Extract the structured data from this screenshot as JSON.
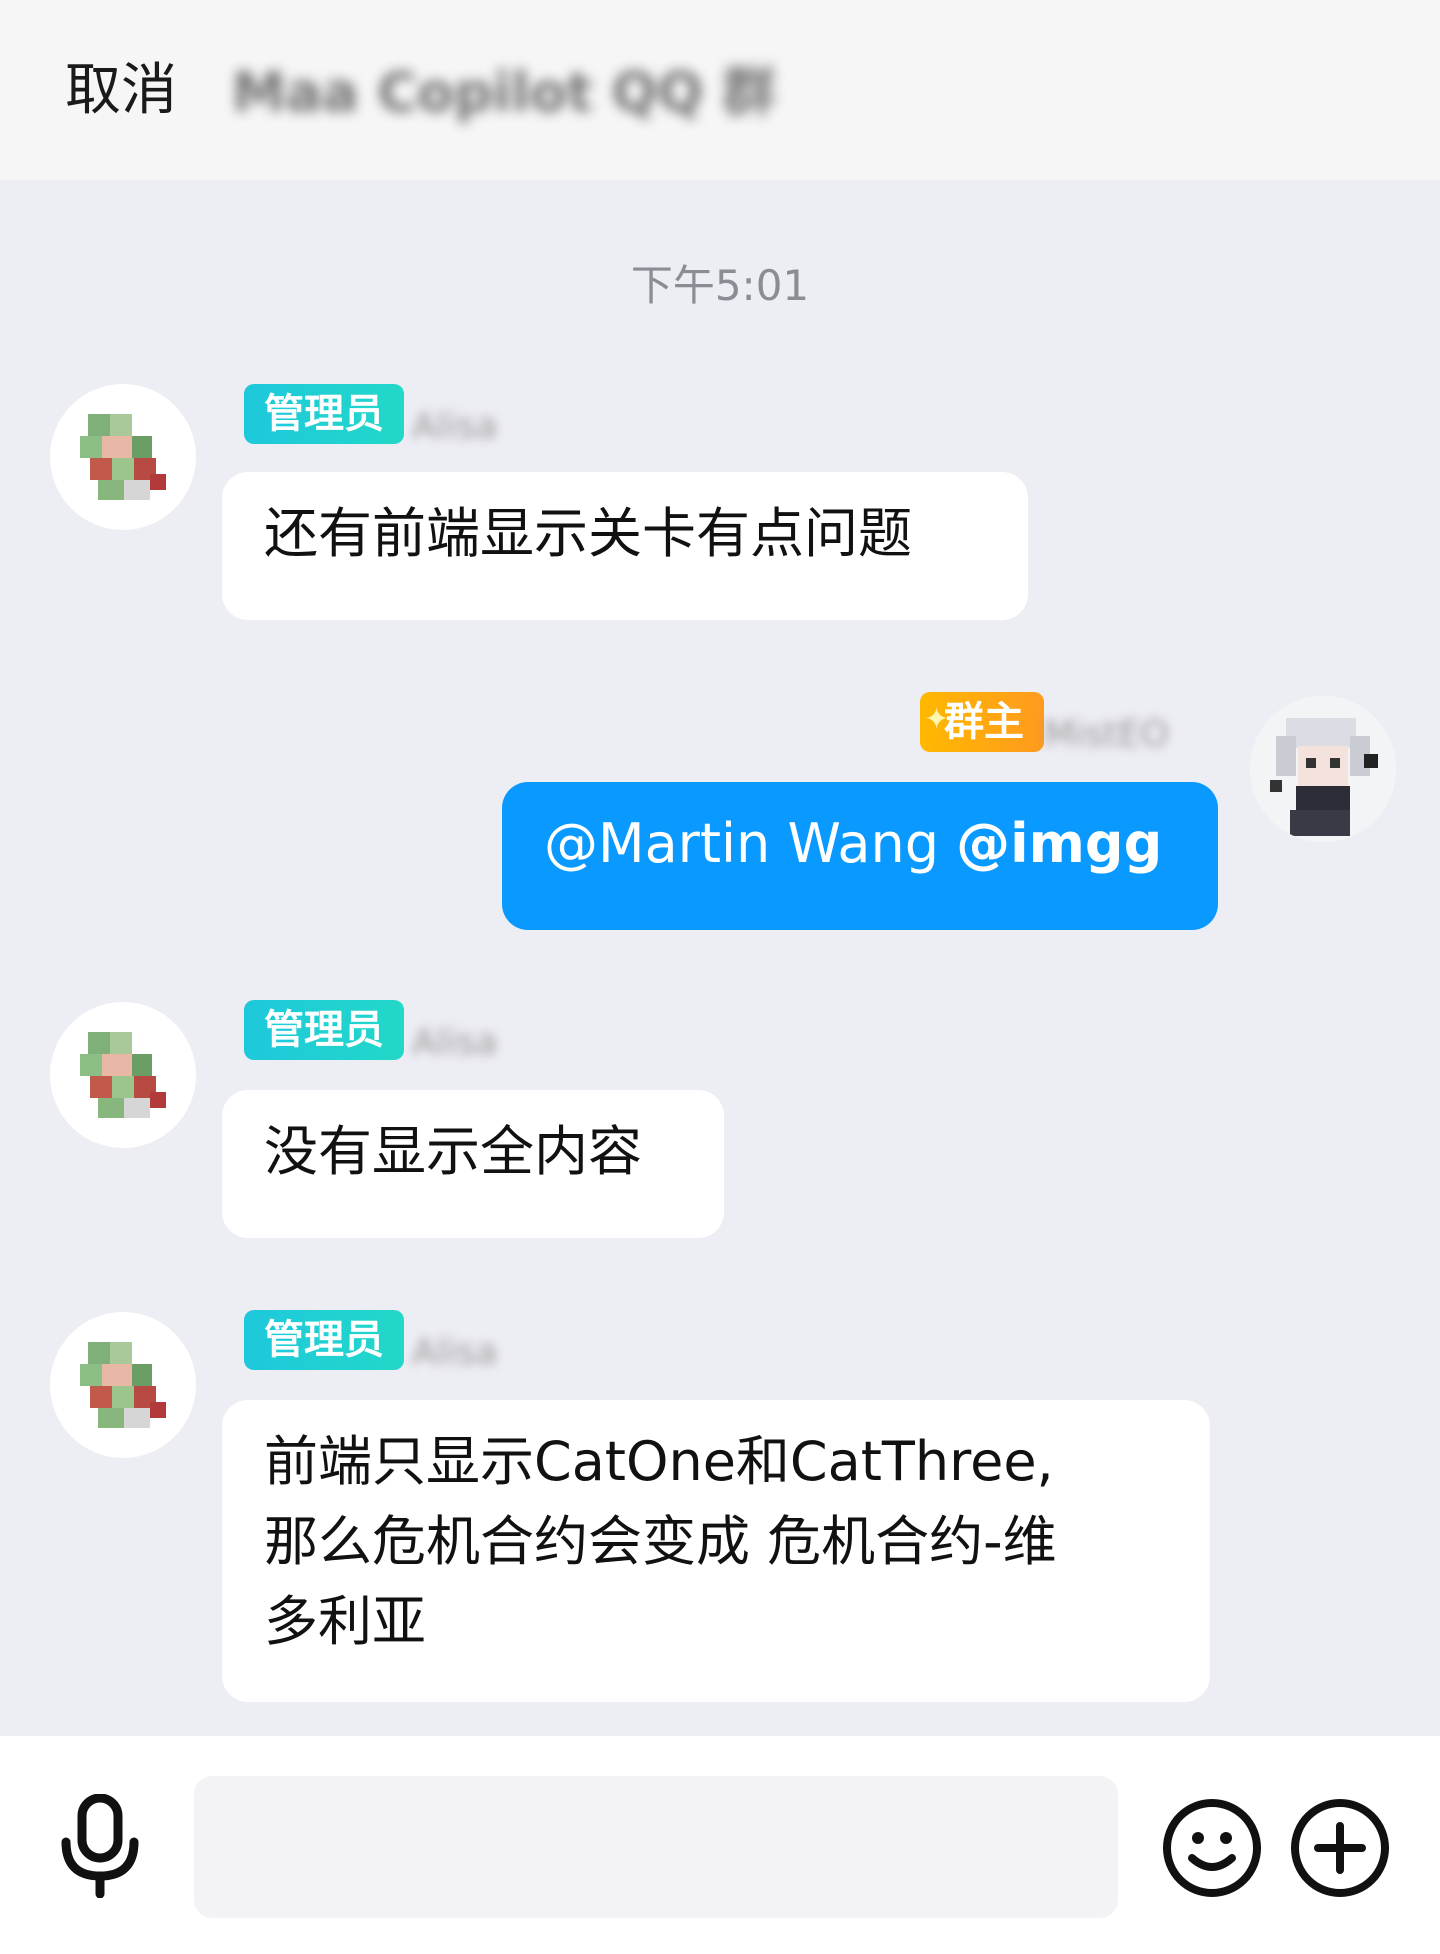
{
  "header": {
    "cancel_label": "取消",
    "group_title": "Maa Copilot QQ 群"
  },
  "chat": {
    "timestamp": "下午5:01",
    "messages": [
      {
        "badge": "管理员",
        "badge_color": "#1ec8dc",
        "nickname": "Alisa",
        "text": "还有前端显示关卡有点问题"
      },
      {
        "badge": "群主",
        "badge_color": "#ffa500",
        "nickname": "MistEO",
        "mention_1": "@Martin Wang ",
        "mention_2": "@imgg"
      },
      {
        "badge": "管理员",
        "badge_color": "#1ec8dc",
        "nickname": "Alisa",
        "text": "没有显示全内容"
      },
      {
        "badge": "管理员",
        "badge_color": "#1ec8dc",
        "nickname": "Alisa",
        "line1": "前端只显示CatOne和CatThree,",
        "line2": "那么危机合约会变成 危机合约-维",
        "line3": "多利亚"
      }
    ]
  },
  "composer": {
    "input_value": "",
    "icons": [
      "microphone-icon",
      "emoji-icon",
      "plus-icon"
    ]
  },
  "colors": {
    "self_bubble": "#0a99ff",
    "other_bubble": "#ffffff",
    "chat_bg": "#ededf4"
  }
}
